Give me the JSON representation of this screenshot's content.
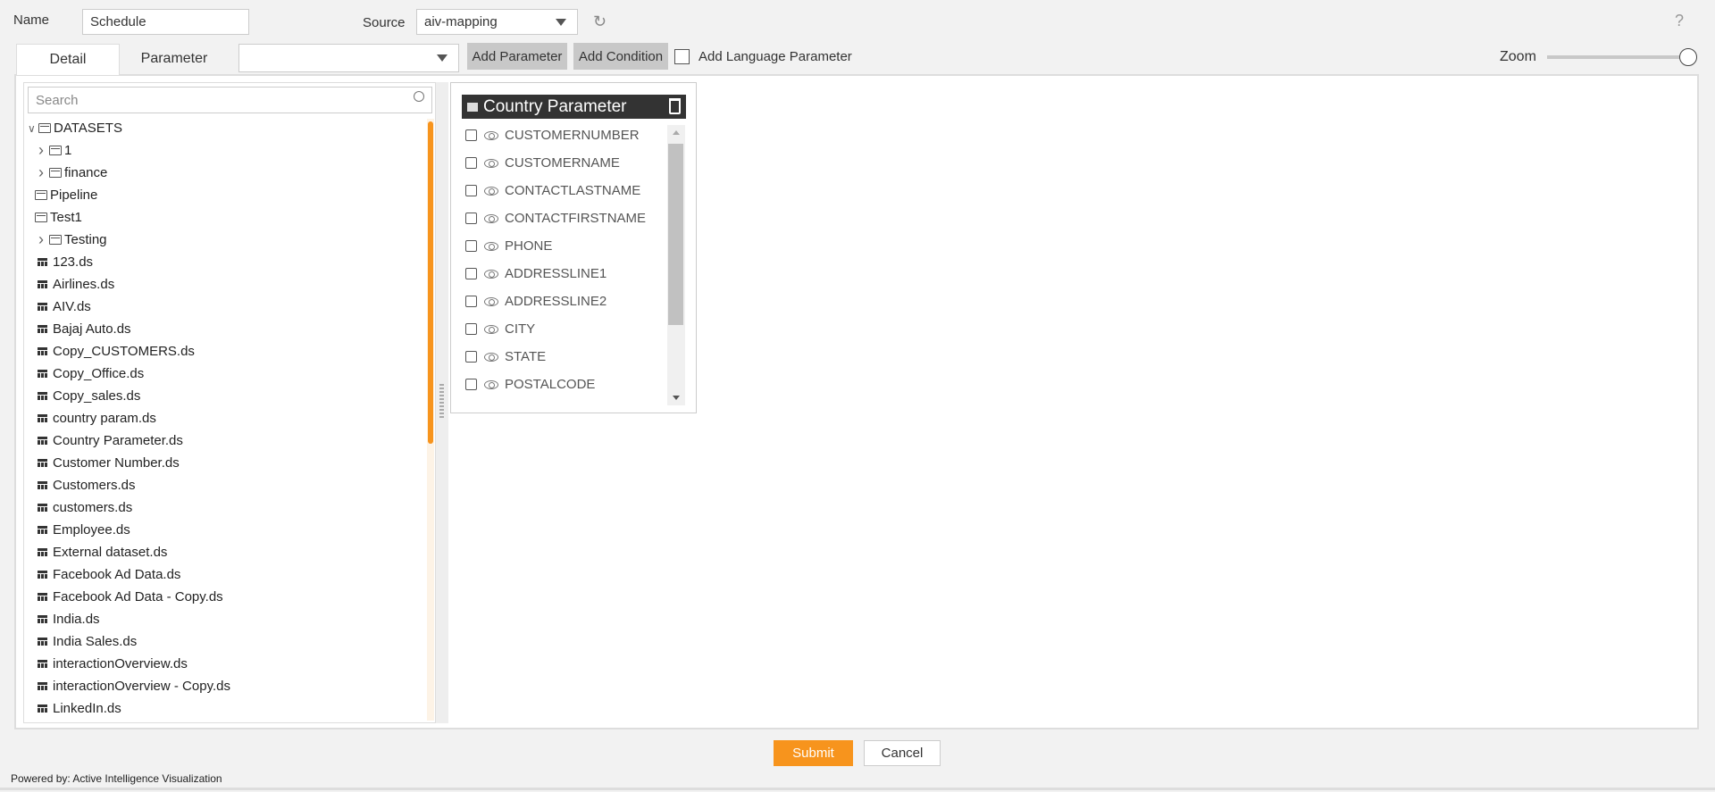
{
  "header": {
    "name_label": "Name",
    "name_value": "Schedule",
    "source_label": "Source",
    "source_value": "aiv-mapping",
    "help": "?"
  },
  "toolbar": {
    "tabs": [
      {
        "label": "Detail",
        "active": true
      },
      {
        "label": "Parameter",
        "active": false
      }
    ],
    "parameter_select_value": "",
    "add_parameter": "Add Parameter",
    "add_condition": "Add Condition",
    "add_language_parameter": "Add Language Parameter",
    "add_language_checked": false,
    "zoom_label": "Zoom",
    "zoom_level": 1.0
  },
  "tree": {
    "search_placeholder": "Search",
    "items": [
      {
        "label": "DATASETS",
        "type": "folder",
        "level": 0,
        "expander": "open"
      },
      {
        "label": "1",
        "type": "folder",
        "level": 1,
        "expander": "closed"
      },
      {
        "label": "finance",
        "type": "folder",
        "level": 1,
        "expander": "closed"
      },
      {
        "label": "Pipeline",
        "type": "folder",
        "level": 1,
        "expander": "none"
      },
      {
        "label": "Test1",
        "type": "folder",
        "level": 1,
        "expander": "none"
      },
      {
        "label": "Testing",
        "type": "folder",
        "level": 1,
        "expander": "closed"
      },
      {
        "label": "123.ds",
        "type": "dataset"
      },
      {
        "label": "Airlines.ds",
        "type": "dataset"
      },
      {
        "label": "AIV.ds",
        "type": "dataset"
      },
      {
        "label": "Bajaj Auto.ds",
        "type": "dataset"
      },
      {
        "label": "Copy_CUSTOMERS.ds",
        "type": "dataset"
      },
      {
        "label": "Copy_Office.ds",
        "type": "dataset"
      },
      {
        "label": "Copy_sales.ds",
        "type": "dataset"
      },
      {
        "label": "country param.ds",
        "type": "dataset"
      },
      {
        "label": "Country Parameter.ds",
        "type": "dataset"
      },
      {
        "label": "Customer Number.ds",
        "type": "dataset"
      },
      {
        "label": "Customers.ds",
        "type": "dataset"
      },
      {
        "label": "customers.ds",
        "type": "dataset"
      },
      {
        "label": "Employee.ds",
        "type": "dataset"
      },
      {
        "label": "External dataset.ds",
        "type": "dataset"
      },
      {
        "label": "Facebook Ad Data.ds",
        "type": "dataset"
      },
      {
        "label": "Facebook Ad Data - Copy.ds",
        "type": "dataset"
      },
      {
        "label": "India.ds",
        "type": "dataset"
      },
      {
        "label": "India Sales.ds",
        "type": "dataset"
      },
      {
        "label": "interactionOverview.ds",
        "type": "dataset"
      },
      {
        "label": "interactionOverview - Copy.ds",
        "type": "dataset"
      },
      {
        "label": "LinkedIn.ds",
        "type": "dataset"
      }
    ]
  },
  "card": {
    "title": "Country Parameter",
    "fields": [
      "CUSTOMERNUMBER",
      "CUSTOMERNAME",
      "CONTACTLASTNAME",
      "CONTACTFIRSTNAME",
      "PHONE",
      "ADDRESSLINE1",
      "ADDRESSLINE2",
      "CITY",
      "STATE",
      "POSTALCODE"
    ]
  },
  "footer": {
    "submit": "Submit",
    "cancel": "Cancel",
    "powered_by": "Powered by: Active Intelligence Visualization"
  },
  "colors": {
    "accent": "#f7941d",
    "scrollbar": "#f7941d",
    "card_header": "#333333"
  }
}
